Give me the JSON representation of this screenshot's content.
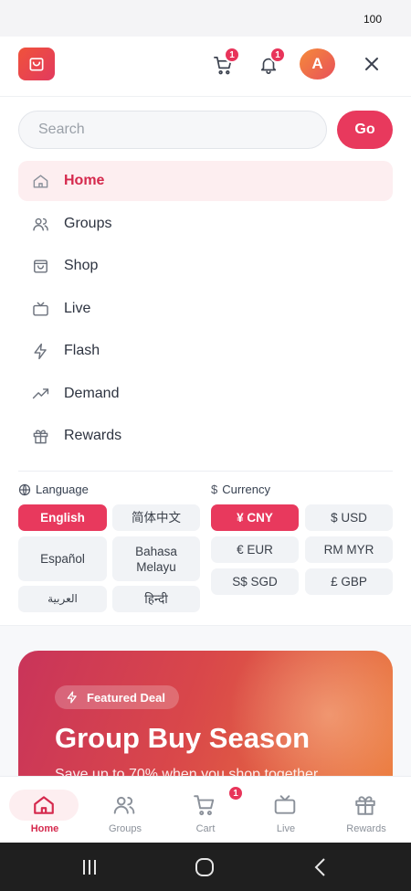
{
  "status_bar": {
    "battery": "100"
  },
  "header": {
    "cart_badge": "1",
    "notification_badge": "1",
    "avatar_initial": "A"
  },
  "search": {
    "placeholder": "Search",
    "go_label": "Go"
  },
  "nav": {
    "items": [
      {
        "label": "Home",
        "icon": "home-icon",
        "active": true
      },
      {
        "label": "Groups",
        "icon": "users-icon"
      },
      {
        "label": "Shop",
        "icon": "shopping-bag-icon"
      },
      {
        "label": "Live",
        "icon": "tv-icon"
      },
      {
        "label": "Flash",
        "icon": "lightning-icon"
      },
      {
        "label": "Demand",
        "icon": "trending-up-icon"
      },
      {
        "label": "Rewards",
        "icon": "gift-icon"
      }
    ]
  },
  "language": {
    "title": "Language",
    "options": [
      "English",
      "简体中文",
      "Español",
      "Bahasa Melayu",
      "العربية",
      "हिन्दी"
    ],
    "selected": "English"
  },
  "currency": {
    "title": "Currency",
    "options": [
      "¥ CNY",
      "$ USD",
      "€ EUR",
      "RM MYR",
      "S$ SGD",
      "£ GBP"
    ],
    "selected": "¥ CNY"
  },
  "promo": {
    "chip": "Featured Deal",
    "title": "Group Buy Season",
    "subtitle": "Save up to 70% when you shop together"
  },
  "bottom_nav": {
    "items": [
      {
        "label": "Home",
        "icon": "home-icon",
        "active": true
      },
      {
        "label": "Groups",
        "icon": "users-icon"
      },
      {
        "label": "Cart",
        "icon": "cart-icon",
        "badge": "1"
      },
      {
        "label": "Live",
        "icon": "tv-icon"
      },
      {
        "label": "Rewards",
        "icon": "gift-icon"
      }
    ]
  },
  "colors": {
    "accent": "#e8395d",
    "accent_soft": "#fdeef0",
    "text": "#2d3340"
  }
}
